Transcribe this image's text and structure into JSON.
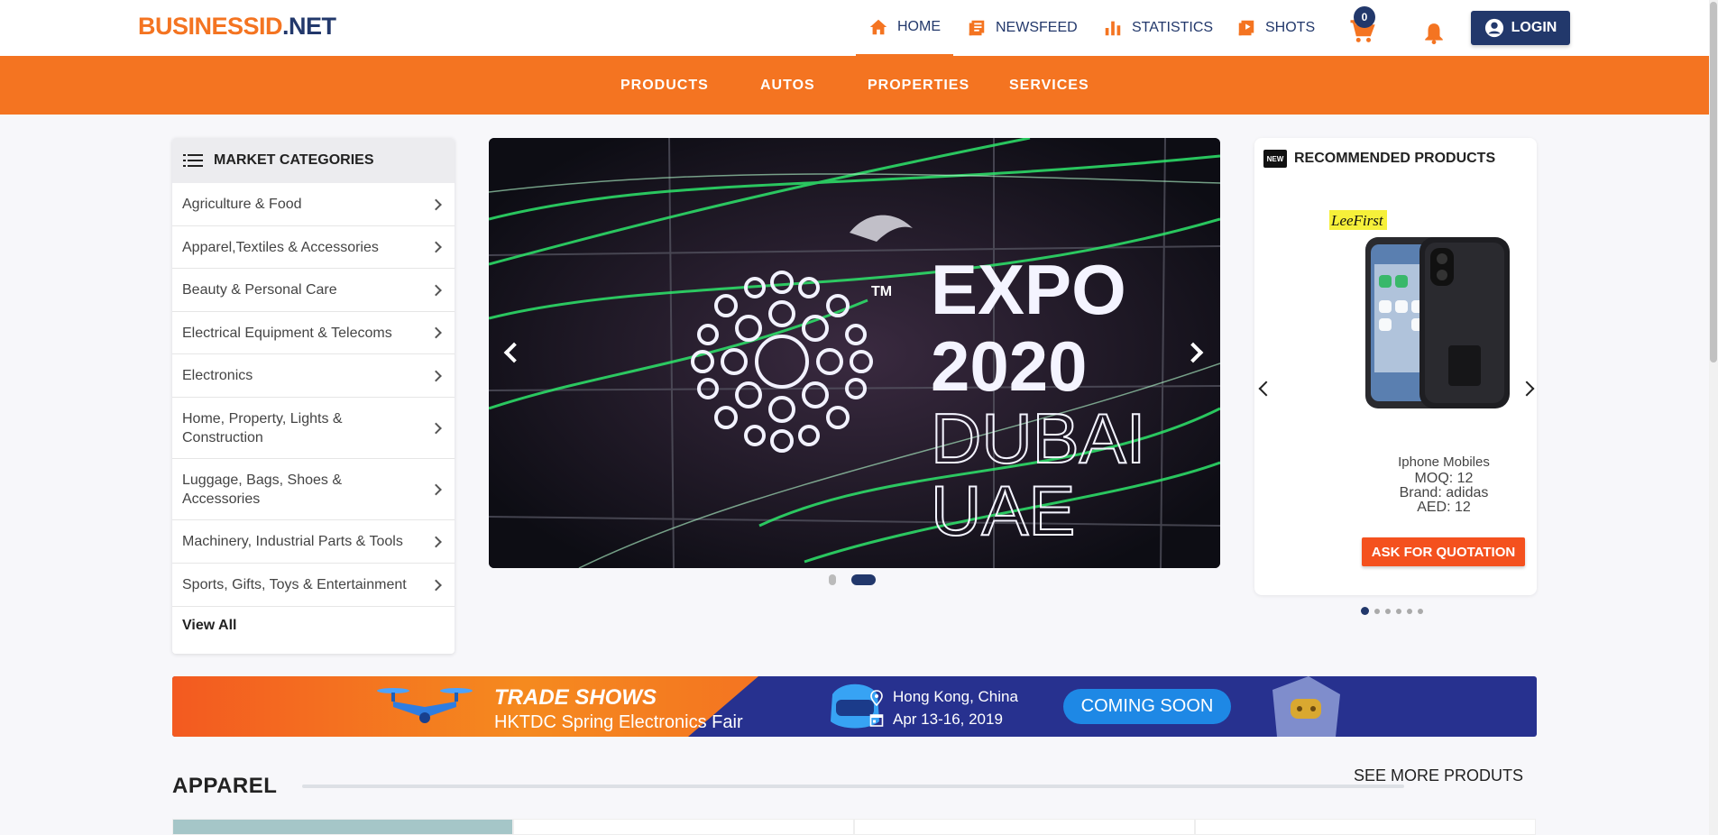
{
  "header": {
    "logo_part1": "BUSINESSID",
    "logo_part2": ".NET",
    "nav": [
      {
        "label": "HOME",
        "icon": "home-icon"
      },
      {
        "label": "NEWSFEED",
        "icon": "newspaper-icon"
      },
      {
        "label": "STATISTICS",
        "icon": "bar-chart-icon"
      },
      {
        "label": "SHOTS",
        "icon": "play-video-icon"
      }
    ],
    "cart_count": "0",
    "login_label": "LOGIN"
  },
  "catbar": {
    "items": [
      "PRODUCTS",
      "AUTOS",
      "PROPERTIES",
      "SERVICES"
    ]
  },
  "categories": {
    "title": "MARKET CATEGORIES",
    "items": [
      "Agriculture & Food",
      "Apparel,Textiles & Accessories",
      "Beauty & Personal Care",
      "Electrical Equipment & Telecoms",
      "Electronics",
      "Home, Property, Lights & Construction",
      "Luggage, Bags, Shoes & Accessories",
      "Machinery, Industrial Parts & Tools",
      "Sports, Gifts, Toys & Entertainment"
    ],
    "view_all": "View All"
  },
  "carousel": {
    "slide_text": [
      "EXPO",
      "2020",
      "DUBAI",
      "UAE"
    ],
    "tm": "TM"
  },
  "recommended": {
    "title": "RECOMMENDED PRODUCTS",
    "new_badge": "NEW",
    "brand_logo": "LeeFirst",
    "product_name": "Iphone Mobiles",
    "moq": "MOQ: 12",
    "brand": "Brand: adidas",
    "price": "AED: 12",
    "quote_label": "ASK FOR QUOTATION"
  },
  "banner": {
    "title": "TRADE SHOWS",
    "subtitle": "HKTDC Spring Electronics Fair",
    "location": "Hong Kong, China",
    "dates": "Apr 13-16, 2019",
    "status": "COMING SOON"
  },
  "section": {
    "title": "APPAREL",
    "see_more": "SEE MORE PRODUTS"
  },
  "colors": {
    "accent": "#f47421",
    "brand": "#22386b"
  }
}
